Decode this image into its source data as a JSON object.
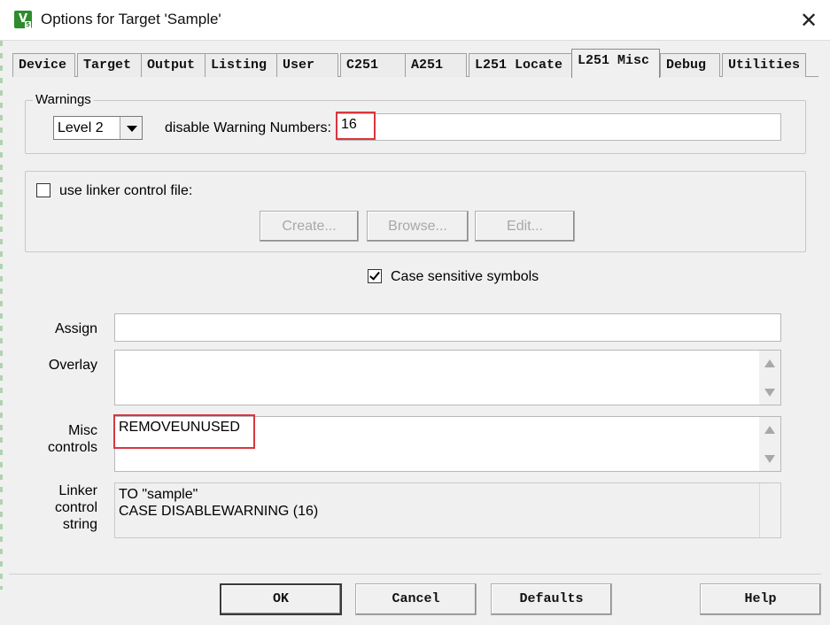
{
  "window": {
    "title": "Options for Target 'Sample'",
    "icon_text": "V",
    "icon_sub": "5",
    "close": "✕"
  },
  "tabs": [
    {
      "label": "Device",
      "active": false
    },
    {
      "label": "Target",
      "active": false
    },
    {
      "label": "Output",
      "active": false
    },
    {
      "label": "Listing",
      "active": false
    },
    {
      "label": "User",
      "active": false
    },
    {
      "label": "C251",
      "active": false
    },
    {
      "label": "A251",
      "active": false
    },
    {
      "label": "L251 Locate",
      "active": false
    },
    {
      "label": "L251 Misc",
      "active": true
    },
    {
      "label": "Debug",
      "active": false
    },
    {
      "label": "Utilities",
      "active": false
    }
  ],
  "warnings": {
    "group_label": "Warnings",
    "level_value": "Level 2",
    "disable_label": "disable Warning Numbers:",
    "disable_value": "16"
  },
  "linker_file": {
    "checkbox_label": "use linker control file:",
    "checked": false,
    "create_label": "Create...",
    "browse_label": "Browse...",
    "edit_label": "Edit..."
  },
  "case_sensitive": {
    "label": "Case sensitive symbols",
    "checked": true
  },
  "assign": {
    "label": "Assign",
    "value": ""
  },
  "overlay": {
    "label": "Overlay",
    "value": ""
  },
  "misc": {
    "label": "Misc\ncontrols",
    "value": "REMOVEUNUSED"
  },
  "linker_string": {
    "label": "Linker\ncontrol\nstring",
    "value": "TO \"sample\"\nCASE DISABLEWARNING (16)"
  },
  "footer": {
    "ok": "OK",
    "cancel": "Cancel",
    "defaults": "Defaults",
    "help": "Help"
  },
  "colors": {
    "highlight": "#d9363e",
    "dialog_bg": "#f0f0f0",
    "icon_green": "#2e8b2e"
  }
}
